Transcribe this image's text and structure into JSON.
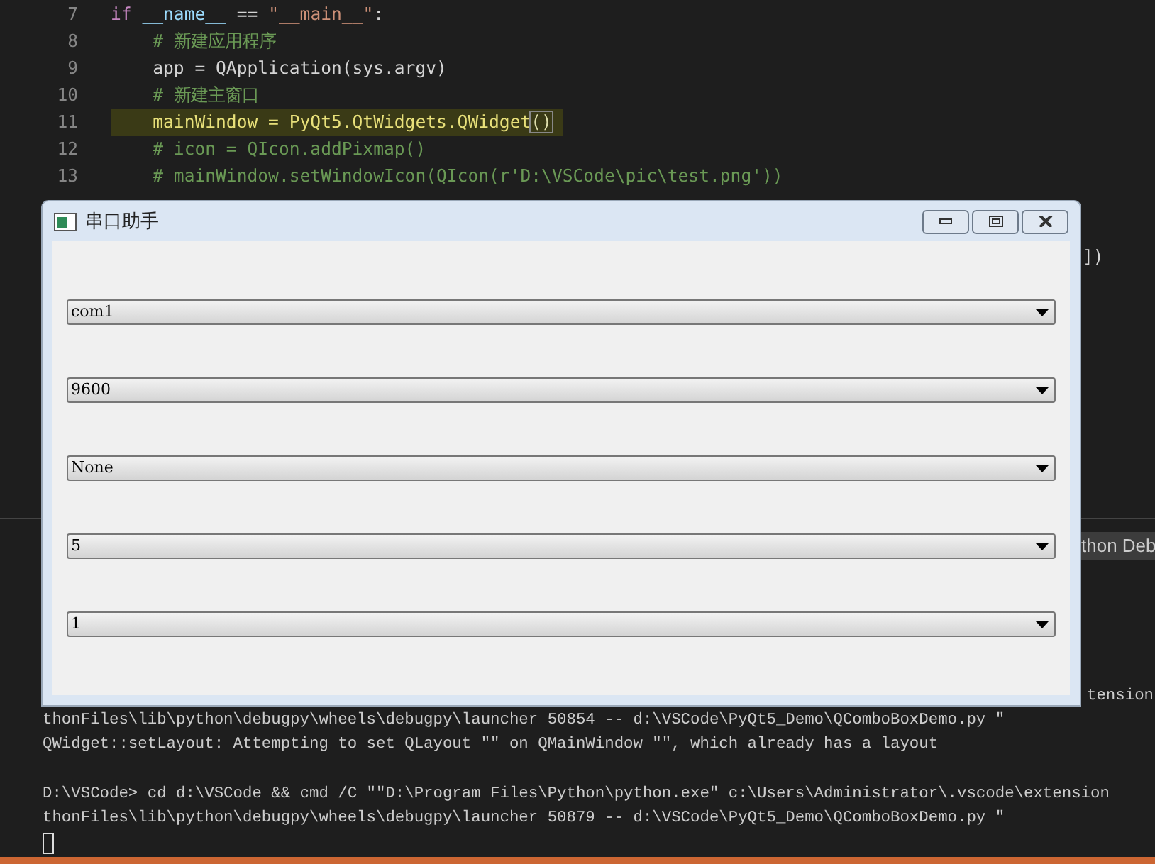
{
  "editor": {
    "lines": [
      {
        "number": "7",
        "highlighted": false,
        "tokens": [
          {
            "kind": "keyword",
            "text": "if "
          },
          {
            "kind": "variable",
            "text": "__name__"
          },
          {
            "kind": "plain",
            "text": " == "
          },
          {
            "kind": "string",
            "text": "\"__main__\""
          },
          {
            "kind": "plain",
            "text": ":"
          }
        ]
      },
      {
        "number": "8",
        "highlighted": false,
        "tokens": [
          {
            "kind": "comment",
            "text": "    # 新建应用程序"
          }
        ]
      },
      {
        "number": "9",
        "highlighted": false,
        "tokens": [
          {
            "kind": "plain",
            "text": "    app = QApplication(sys.argv)"
          }
        ]
      },
      {
        "number": "10",
        "highlighted": false,
        "tokens": [
          {
            "kind": "comment",
            "text": "    # 新建主窗口"
          }
        ]
      },
      {
        "number": "11",
        "highlighted": true,
        "tokens": [
          {
            "kind": "plain",
            "text": "    mainWindow = PyQt5.QtWidgets.QWidget"
          },
          {
            "kind": "bracket",
            "text": "()"
          }
        ]
      },
      {
        "number": "12",
        "highlighted": false,
        "tokens": [
          {
            "kind": "comment",
            "text": "    # icon = QIcon.addPixmap()"
          }
        ]
      },
      {
        "number": "13",
        "highlighted": false,
        "tokens": [
          {
            "kind": "comment",
            "text": "    # mainWindow.setWindowIcon(QIcon(r'D:\\VSCode\\pic\\test.png'))"
          }
        ]
      }
    ],
    "hidden_line_tail": "])"
  },
  "panel": {
    "dropdown_fragment": "thon Deb"
  },
  "terminal": {
    "blocks": [
      [
        "tension",
        "thonFiles\\lib\\python\\debugpy\\wheels\\debugpy\\launcher 50854 -- d:\\VSCode\\PyQt5_Demo\\QComboBoxDemo.py \"",
        "QWidget::setLayout: Attempting to set QLayout \"\" on QMainWindow \"\", which already has a layout"
      ],
      [
        "D:\\VSCode> cd d:\\VSCode && cmd /C \"\"D:\\Program Files\\Python\\python.exe\" c:\\Users\\Administrator\\.vscode\\extension",
        "thonFiles\\lib\\python\\debugpy\\wheels\\debugpy\\launcher 50879 -- d:\\VSCode\\PyQt5_Demo\\QComboBoxDemo.py \""
      ]
    ]
  },
  "window": {
    "title": "串口助手",
    "combos": [
      {
        "value": "com1"
      },
      {
        "value": "9600"
      },
      {
        "value": "None"
      },
      {
        "value": "5"
      },
      {
        "value": "1"
      }
    ]
  }
}
